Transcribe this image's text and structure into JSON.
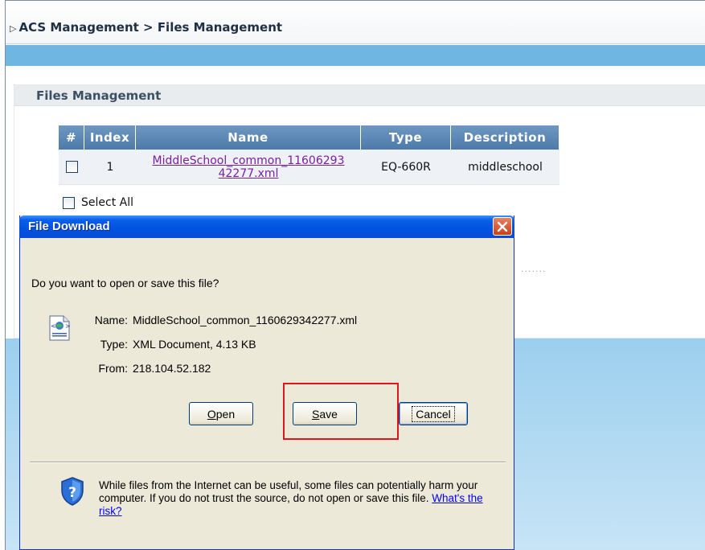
{
  "breadcrumb": {
    "text": "ACS Management > Files Management"
  },
  "panel": {
    "title": "Files Management"
  },
  "table": {
    "headers": [
      "#",
      "Index",
      "Name",
      "Type",
      "Description"
    ],
    "rows": [
      {
        "index": "1",
        "name_line1": "MiddleSchool_common_11606293",
        "name_line2": "42277.xml",
        "type": "EQ-660R",
        "description": "middleschool"
      }
    ]
  },
  "select_all": {
    "label": "Select All"
  },
  "dialog": {
    "title": "File Download",
    "prompt": "Do you want to open or save this file?",
    "name_label": "Name:",
    "name_value": "MiddleSchool_common_1160629342277.xml",
    "type_label": "Type:",
    "type_value": "XML Document, 4.13 KB",
    "from_label": "From:",
    "from_value": "218.104.52.182",
    "buttons": {
      "open_rest": "pen",
      "open_key": "O",
      "save_rest": "ave",
      "save_key": "S",
      "cancel": "Cancel"
    },
    "warning_text": "While files from the Internet can be useful, some files can potentially harm your computer. If you do not trust the source, do not open or save this file.",
    "risk_link": "What's the risk?"
  },
  "colors": {
    "highlight": "#e0161c",
    "titlebar": "#0052e0",
    "header": "#5a84b1",
    "link": "#7a1fa2"
  }
}
